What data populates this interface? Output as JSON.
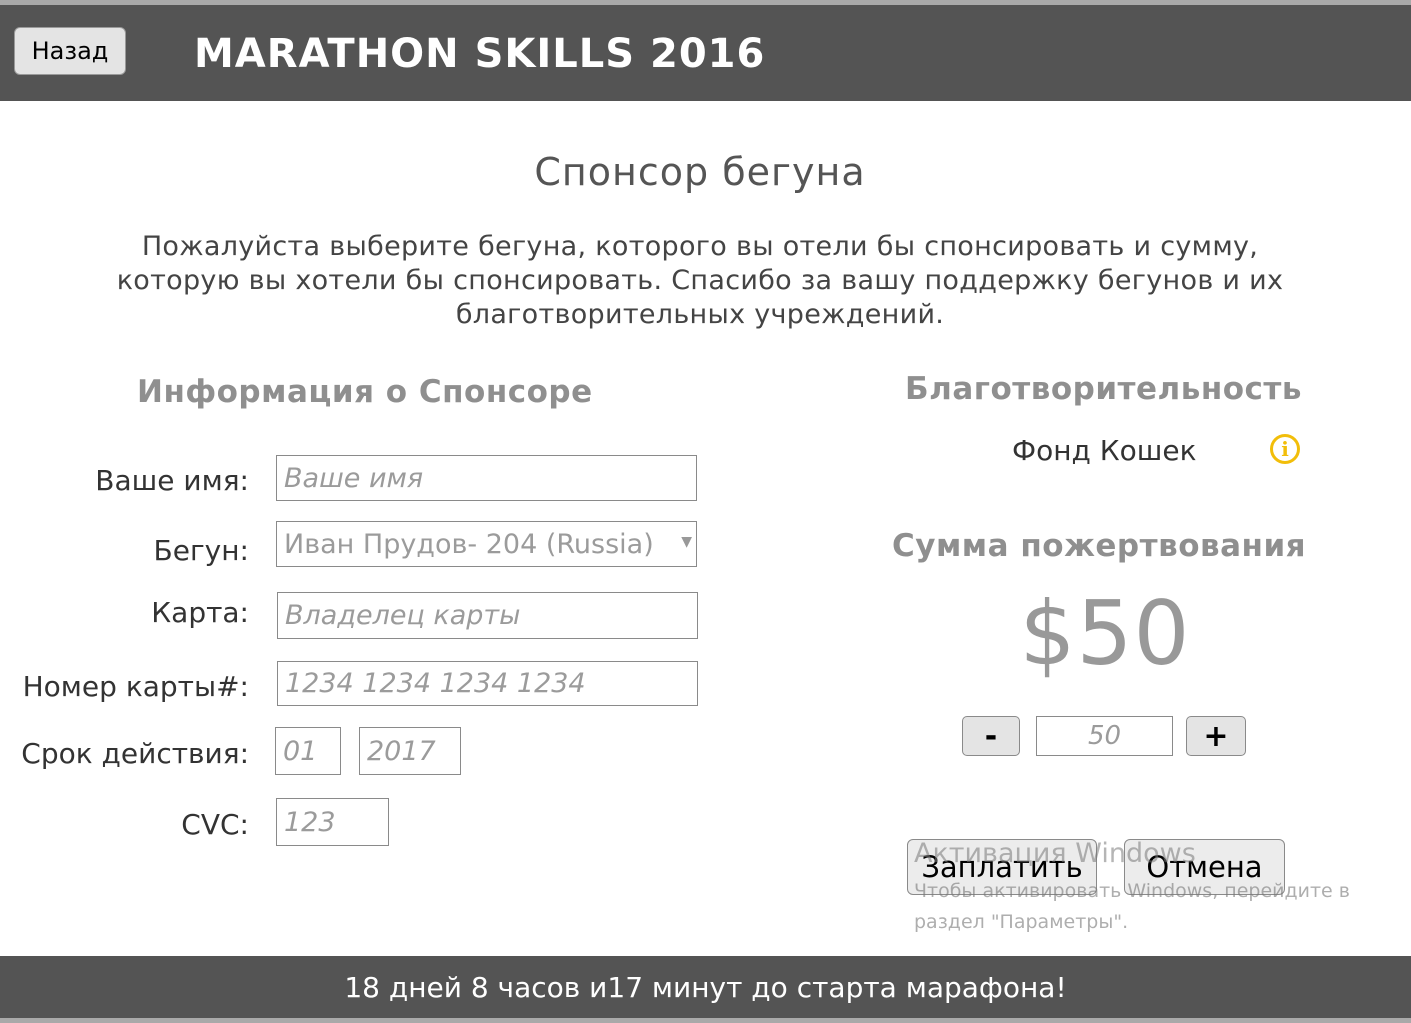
{
  "header": {
    "back_label": "Назад",
    "title": "MARATHON SKILLS 2016"
  },
  "page": {
    "title": "Спонсор бегуна",
    "intro_line1": "Пожалуйста выберите бегуна, которого вы отели бы спонсировать и сумму,",
    "intro_line2": "которую вы хотели бы спонсировать. Спасибо за вашу поддержку бегунов и их",
    "intro_line3": "благотворительных учреждений."
  },
  "sponsor": {
    "section_title": "Информация о Спонсоре",
    "name_label": "Ваше имя:",
    "name_placeholder": "Ваше имя",
    "runner_label": "Бегун:",
    "runner_selected": "Иван Прудов- 204 (Russia)",
    "card_label": "Карта:",
    "card_placeholder": "Владелец карты",
    "card_number_label": "Номер карты#:",
    "card_number_placeholder": "1234 1234 1234 1234",
    "expiry_label": "Срок действия:",
    "expiry_month_placeholder": "01",
    "expiry_year_placeholder": "2017",
    "cvc_label": "CVC:",
    "cvc_placeholder": "123"
  },
  "charity": {
    "section_title": "Благотворительность",
    "name": "Фонд Кошек",
    "info_icon": "info-icon"
  },
  "donation": {
    "section_title": "Сумма пожертвования",
    "amount_display": "$50",
    "minus_label": "-",
    "amount_value": "50",
    "plus_label": "+"
  },
  "actions": {
    "pay_label": "Заплатить",
    "cancel_label": "Отмена"
  },
  "watermark": {
    "line1": "Активация Windows",
    "line2": "Чтобы активировать Windows, перейдите в раздел \"Параметры\"."
  },
  "footer": {
    "countdown": "18 дней 8 часов и17 минут до старта марафона!"
  },
  "colors": {
    "header_bg": "#545454",
    "info_icon": "#f2be0a",
    "section_title": "#8f8f8f"
  }
}
